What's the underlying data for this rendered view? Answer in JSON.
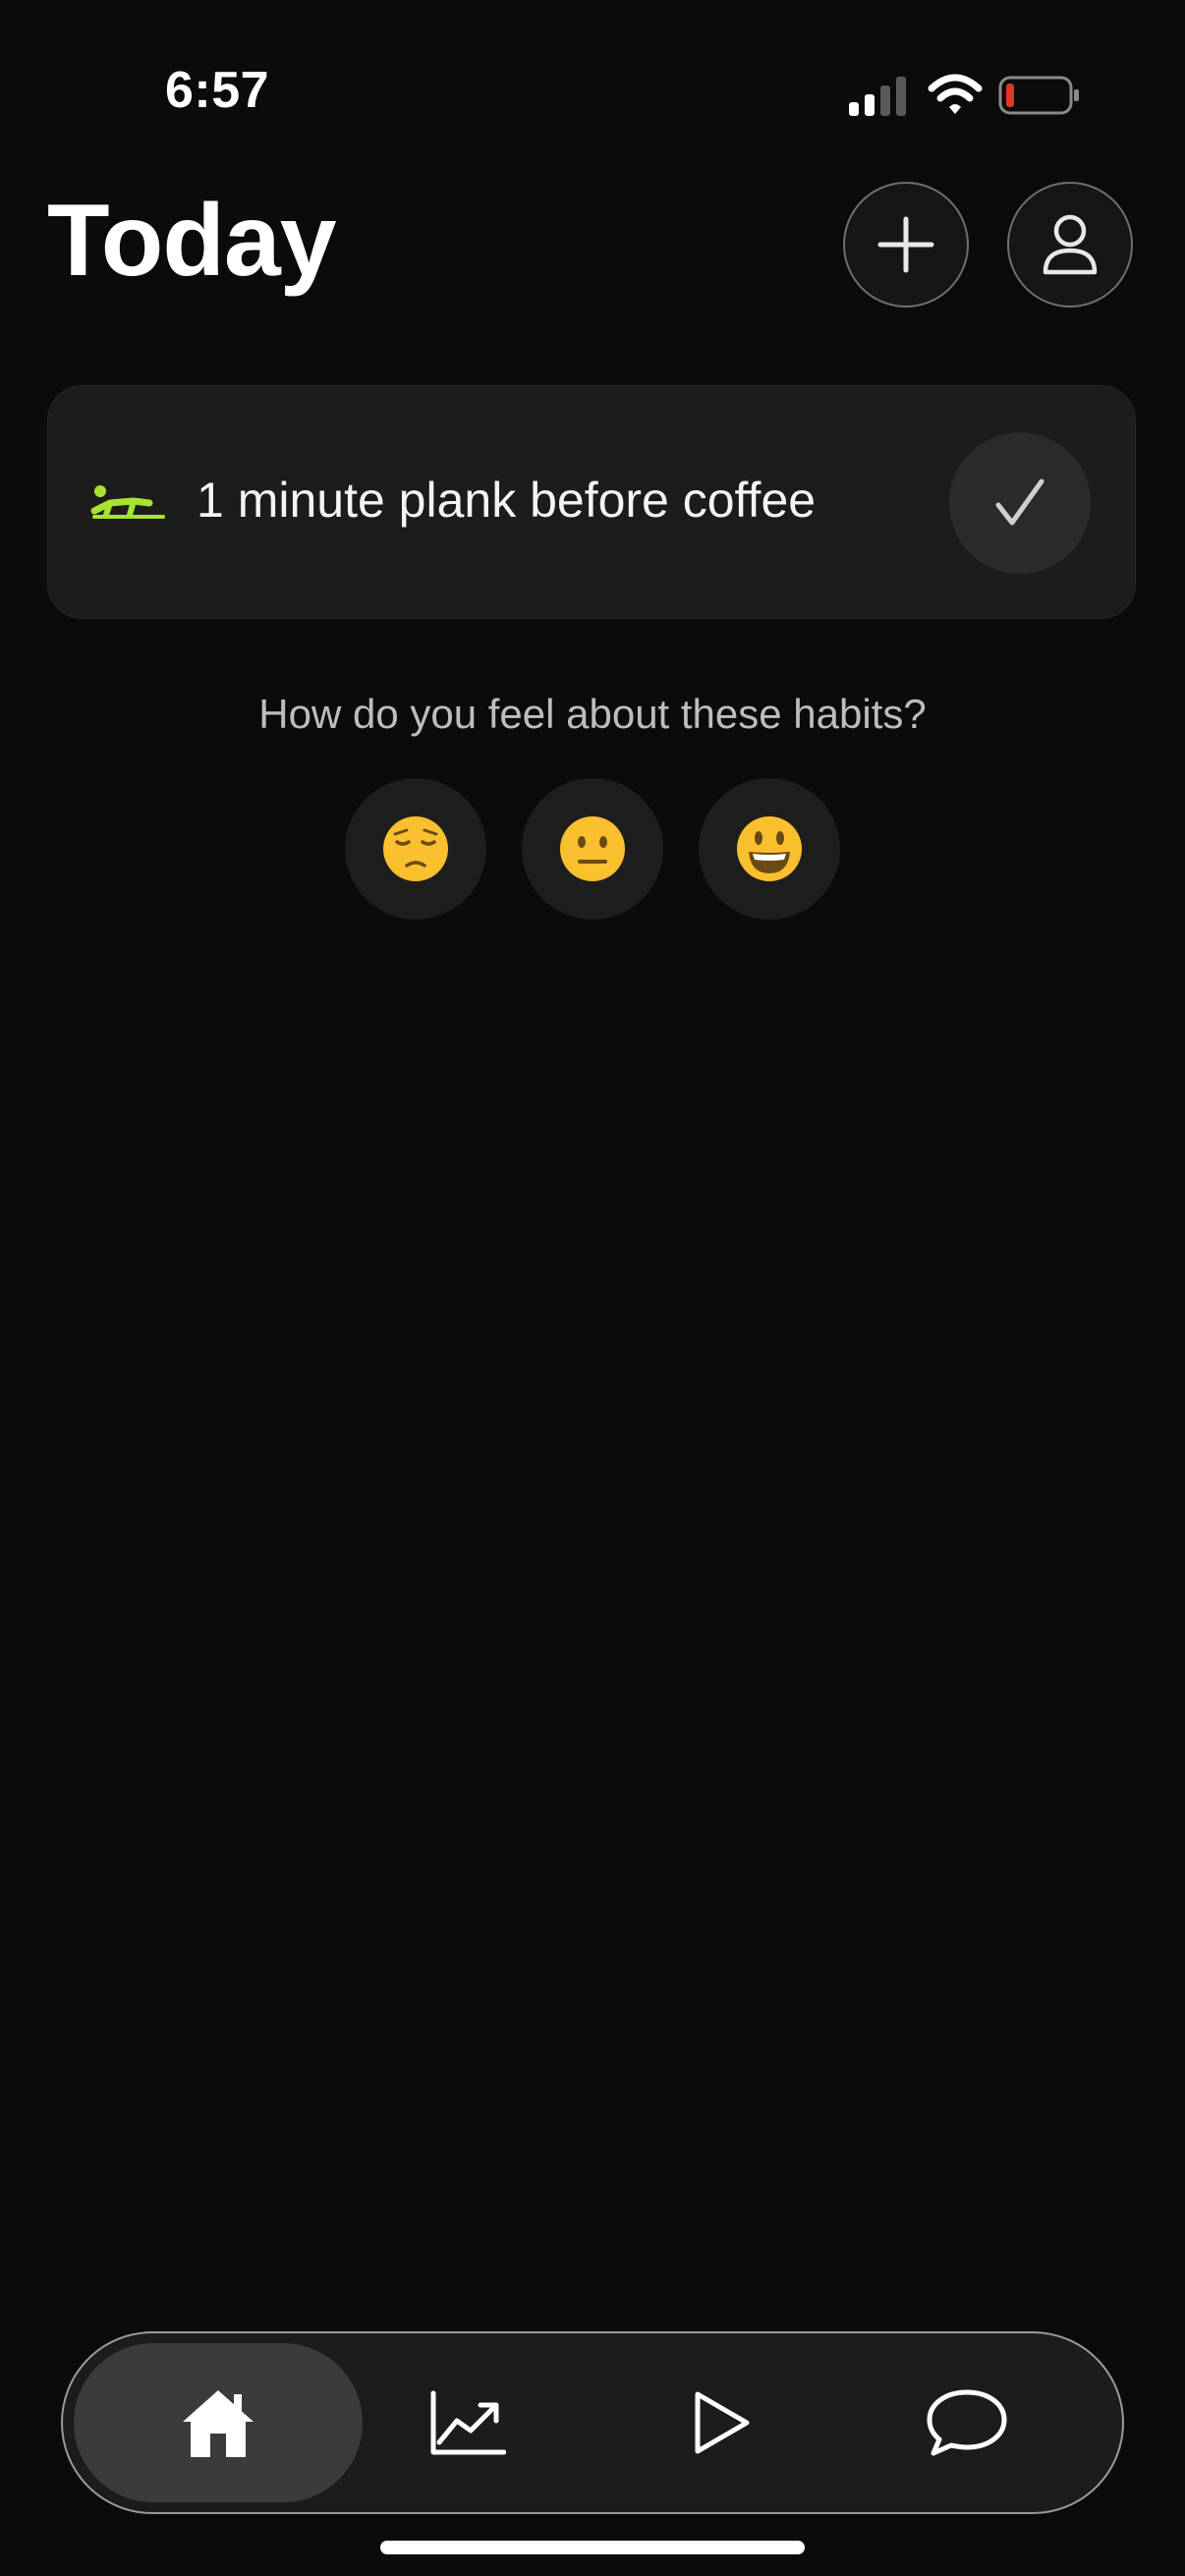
{
  "status_bar": {
    "time": "6:57",
    "battery_color": "#e0342c"
  },
  "header": {
    "title": "Today"
  },
  "habits": [
    {
      "label": "1 minute plank before coffee",
      "icon": "plank-icon",
      "icon_color": "#a6e22e"
    }
  ],
  "mood": {
    "question": "How do you feel about these habits?",
    "options": [
      {
        "emoji": "😔",
        "name": "pensive-face"
      },
      {
        "emoji": "😐",
        "name": "neutral-face"
      },
      {
        "emoji": "😃",
        "name": "smiling-face"
      }
    ]
  },
  "tabbar": {
    "tabs": [
      {
        "name": "home",
        "icon": "home-icon",
        "selected": true
      },
      {
        "name": "stats",
        "icon": "chart-icon",
        "selected": false
      },
      {
        "name": "play",
        "icon": "play-icon",
        "selected": false
      },
      {
        "name": "chat",
        "icon": "chat-icon",
        "selected": false
      }
    ]
  }
}
